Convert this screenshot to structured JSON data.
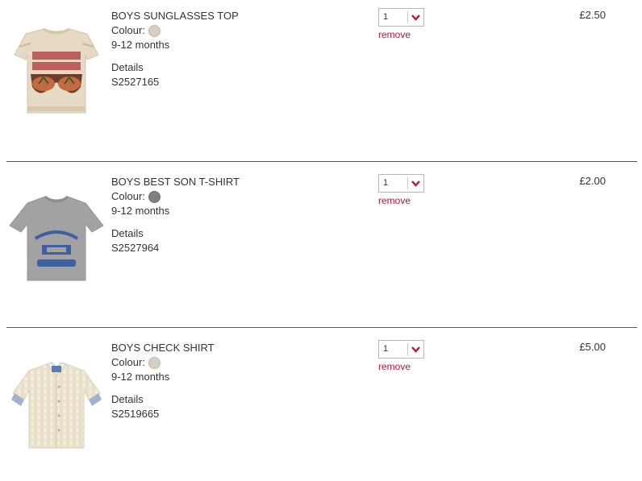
{
  "items": [
    {
      "name": "BOYS SUNGLASSES TOP",
      "colour_label": "Colour:",
      "colour_hex": "#d8cfc2",
      "size": "9-12 months",
      "details_label": "Details",
      "sku": "S2527165",
      "quantity": "1",
      "remove_label": "remove",
      "price": "£2.50",
      "image_icon": "sunglasses-tshirt"
    },
    {
      "name": "BOYS BEST SON T-SHIRT",
      "colour_label": "Colour:",
      "colour_hex": "#7f7f7f",
      "size": "9-12 months",
      "details_label": "Details",
      "sku": "S2527964",
      "quantity": "1",
      "remove_label": "remove",
      "price": "£2.00",
      "image_icon": "grey-tshirt"
    },
    {
      "name": "BOYS CHECK SHIRT",
      "colour_label": "Colour:",
      "colour_hex": "#d8cfc2",
      "size": "9-12 months",
      "details_label": "Details",
      "sku": "S2519665",
      "quantity": "1",
      "remove_label": "remove",
      "price": "£5.00",
      "image_icon": "check-shirt"
    }
  ],
  "colors": {
    "accent": "#c8102e",
    "divider": "#555555",
    "text": "#333333"
  }
}
